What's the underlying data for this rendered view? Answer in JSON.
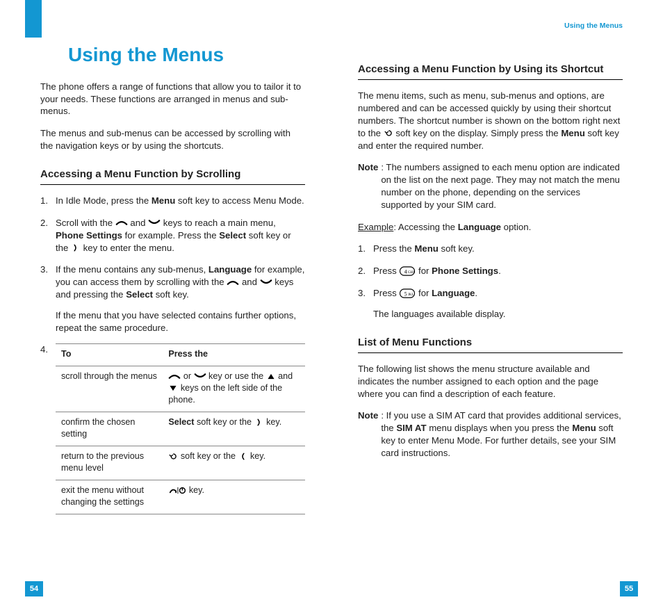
{
  "running_header": "Using the Menus",
  "title": "Using the Menus",
  "intro_p1": "The phone offers a range of functions that allow you to tailor it to your needs. These functions are arranged in menus and sub-menus.",
  "intro_p2": "The menus and sub-menus can be accessed by scrolling with the navigation keys or by using the shortcuts.",
  "sec_scroll_title": "Accessing a Menu Function by Scrolling",
  "scroll_step1_a": "In Idle Mode, press the ",
  "scroll_step1_menu": "Menu",
  "scroll_step1_b": " soft key to access Menu Mode.",
  "scroll_step2_a": "Scroll with the ",
  "scroll_step2_b": " and ",
  "scroll_step2_c": " keys to reach a main menu, ",
  "scroll_step2_phone": "Phone Settings",
  "scroll_step2_d": " for example. Press the ",
  "scroll_step2_select": "Select",
  "scroll_step2_e": " soft key or the ",
  "scroll_step2_f": " key to enter the menu.",
  "scroll_step3_a": "If the menu contains any sub-menus, ",
  "scroll_step3_lang": "Language",
  "scroll_step3_b": " for example, you can access them by scrolling with the ",
  "scroll_step3_c": " and ",
  "scroll_step3_d": " keys and pressing the ",
  "scroll_step3_select": "Select",
  "scroll_step3_e": " soft key.",
  "scroll_step3_p2": "If the menu that you have selected contains further options, repeat the same procedure.",
  "table_h1": "To",
  "table_h2": "Press the",
  "table_r1c1": "scroll through the menus",
  "table_r1c2_a": " or ",
  "table_r1c2_b": " key or use the ",
  "table_r1c2_c": " and ",
  "table_r1c2_d": " keys on the left side of the phone.",
  "table_r2c1": "confirm the chosen setting",
  "table_r2c2_select": "Select",
  "table_r2c2_a": " soft key or the ",
  "table_r2c2_b": " key.",
  "table_r3c1": "return to the previous menu level",
  "table_r3c2_a": " soft key or the ",
  "table_r3c2_b": " key.",
  "table_r4c1": "exit the menu without changing the settings",
  "table_r4c2_a": " key.",
  "sec_shortcut_title": "Accessing a Menu Function by Using its Shortcut",
  "shortcut_p1_a": "The menu items, such as menu, sub-menus and options, are numbered and can be accessed quickly by using their shortcut numbers. The shortcut number is shown on the bottom right next to the ",
  "shortcut_p1_b": " soft key on the display. Simply press the ",
  "shortcut_p1_menu": "Menu",
  "shortcut_p1_c": " soft key and enter the required number.",
  "note1_label": "Note",
  "note1_body": ": The numbers assigned to each menu option are indicated on the list on the next page. They may not match the menu number on the phone, depending on the services supported by your SIM card.",
  "example_a": "Example",
  "example_b": ": Accessing the ",
  "example_lang": "Language",
  "example_c": " option.",
  "ex_step1_a": "Press the ",
  "ex_step1_menu": "Menu",
  "ex_step1_b": " soft key.",
  "ex_step2_a": "Press ",
  "ex_step2_b": " for ",
  "ex_step2_phone": "Phone Settings",
  "ex_step2_c": ".",
  "ex_step3_a": "Press ",
  "ex_step3_b": " for ",
  "ex_step3_lang": "Language",
  "ex_step3_c": ".",
  "ex_step3_p2": "The languages available display.",
  "sec_list_title": "List of Menu Functions",
  "list_p1": "The following list shows the menu structure available and indicates the number assigned to each option and the page where you can find a description of each feature.",
  "note2_label": "Note",
  "note2_body_a": ": If you use a SIM AT card that provides additional services, the ",
  "note2_simat": "SIM AT",
  "note2_body_b": " menu displays when you press the ",
  "note2_menu": "Menu",
  "note2_body_c": " soft key to enter Menu Mode. For further details, see your SIM card instructions.",
  "page_left_num": "54",
  "page_right_num": "55"
}
